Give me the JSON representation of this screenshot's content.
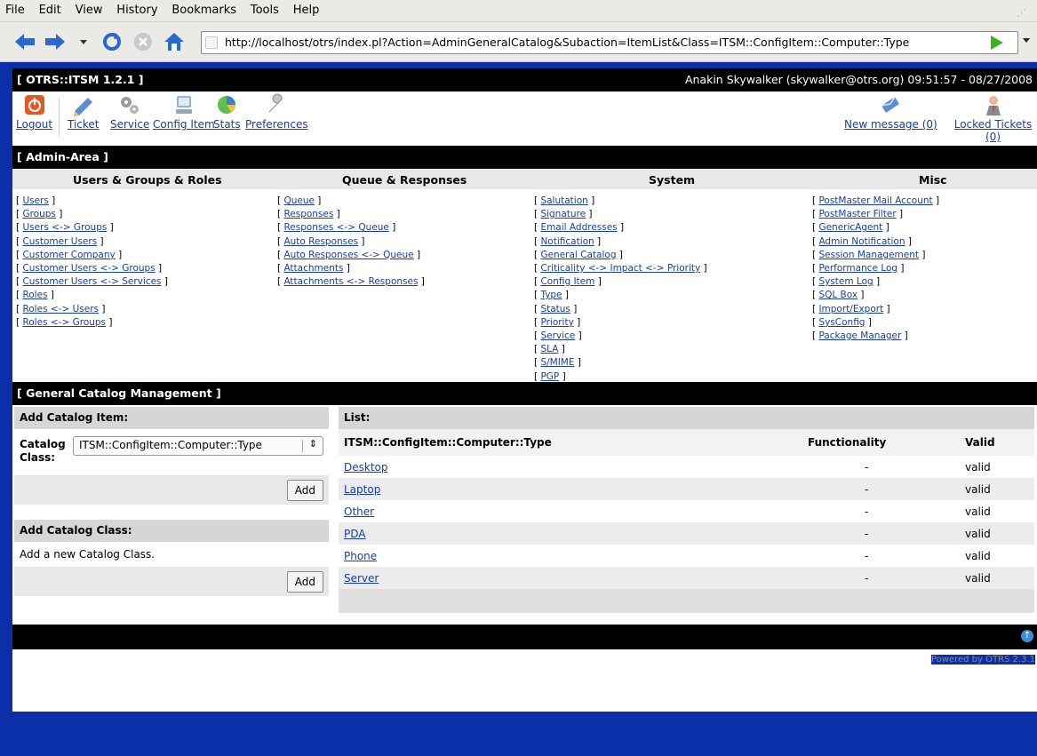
{
  "browser": {
    "menu": [
      "File",
      "Edit",
      "View",
      "History",
      "Bookmarks",
      "Tools",
      "Help"
    ],
    "url": "http://localhost/otrs/index.pl?Action=AdminGeneralCatalog&Subaction=ItemList&Class=ITSM::ConfigItem::Computer::Type"
  },
  "header": {
    "title": "[ OTRS::ITSM 1.2.1 ]",
    "user_info": "Anakin Skywalker (skywalker@otrs.org) 09:51:57 - 08/27/2008"
  },
  "toolbar": {
    "logout": "Logout",
    "ticket": "Ticket",
    "service": "Service",
    "config_item": "Config Item",
    "stats": "Stats",
    "preferences": "Preferences",
    "new_message": "New message (0)",
    "locked_tickets": "Locked Tickets (0)"
  },
  "admin_area": {
    "title": "[ Admin-Area ]",
    "col_users": "Users & Groups & Roles",
    "col_queue": "Queue & Responses",
    "col_system": "System",
    "col_misc": "Misc",
    "users_links": [
      "Users",
      "Groups",
      "Users <-> Groups",
      "Customer Users",
      "Customer Company",
      "Customer Users <-> Groups",
      "Customer Users <-> Services",
      "Roles",
      "Roles <-> Users",
      "Roles <-> Groups"
    ],
    "queue_links": [
      "Queue",
      "Responses",
      "Responses <-> Queue",
      "Auto Responses",
      "Auto Responses <-> Queue",
      "Attachments",
      "Attachments <-> Responses"
    ],
    "system_links": [
      "Salutation",
      "Signature",
      "Email Addresses",
      "Notification",
      "General Catalog",
      "Criticality <-> Impact <-> Priority",
      "Config Item",
      "Type",
      "Status",
      "Priority",
      "Service",
      "SLA",
      "S/MIME",
      "PGP"
    ],
    "misc_links": [
      "PostMaster Mail Account",
      "PostMaster Filter",
      "GenericAgent",
      "Admin Notification",
      "Session Management",
      "Performance Log",
      "System Log",
      "SQL Box",
      "Import/Export",
      "SysConfig",
      "Package Manager"
    ]
  },
  "catalog": {
    "title": "[ General Catalog Management ]",
    "add_item_head": "Add Catalog Item:",
    "catalog_class_label": "Catalog Class:",
    "catalog_class_value": "ITSM::ConfigItem::Computer::Type",
    "add_button": "Add",
    "add_class_head": "Add Catalog Class:",
    "add_class_text": "Add a new Catalog Class.",
    "add_class_button": "Add",
    "list_head": "List:",
    "col_name": "ITSM::ConfigItem::Computer::Type",
    "col_functionality": "Functionality",
    "col_valid": "Valid",
    "rows": [
      {
        "name": "Desktop",
        "functionality": "-",
        "valid": "valid"
      },
      {
        "name": "Laptop",
        "functionality": "-",
        "valid": "valid"
      },
      {
        "name": "Other",
        "functionality": "-",
        "valid": "valid"
      },
      {
        "name": "PDA",
        "functionality": "-",
        "valid": "valid"
      },
      {
        "name": "Phone",
        "functionality": "-",
        "valid": "valid"
      },
      {
        "name": "Server",
        "functionality": "-",
        "valid": "valid"
      }
    ]
  },
  "footer": {
    "powered": "Powered by OTRS 2.3.1"
  }
}
